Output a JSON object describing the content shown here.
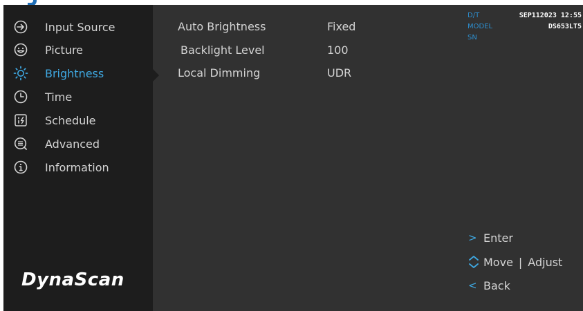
{
  "menu": {
    "items": [
      {
        "label": "Input Source",
        "icon": "input-source-icon"
      },
      {
        "label": "Picture",
        "icon": "picture-icon"
      },
      {
        "label": "Brightness",
        "icon": "brightness-icon",
        "active": true
      },
      {
        "label": "Time",
        "icon": "clock-icon"
      },
      {
        "label": "Schedule",
        "icon": "schedule-icon"
      },
      {
        "label": "Advanced",
        "icon": "advanced-icon"
      },
      {
        "label": "Information",
        "icon": "info-icon"
      }
    ]
  },
  "brand": {
    "logo_text": "DynaScan"
  },
  "settings": {
    "rows": [
      {
        "label": "Auto Brightness",
        "value": "Fixed"
      },
      {
        "label": "Backlight Level",
        "value": "100"
      },
      {
        "label": "Local Dimming",
        "value": "UDR"
      }
    ]
  },
  "info": {
    "dt_label": "D/T",
    "dt_value": "SEP112023 12:55",
    "model_label": "MODEL",
    "model_value": "DS653LT5",
    "sn_label": "SN"
  },
  "hints": {
    "enter_glyph": ">",
    "enter": "Enter",
    "move": "Move",
    "divider": "|",
    "adjust": "Adjust",
    "back_glyph": "<",
    "back": "Back"
  },
  "colors": {
    "accent": "#3fa9e3",
    "sidebar": "#1d1d1d",
    "panel": "#313131",
    "text": "#d4d4d4"
  }
}
